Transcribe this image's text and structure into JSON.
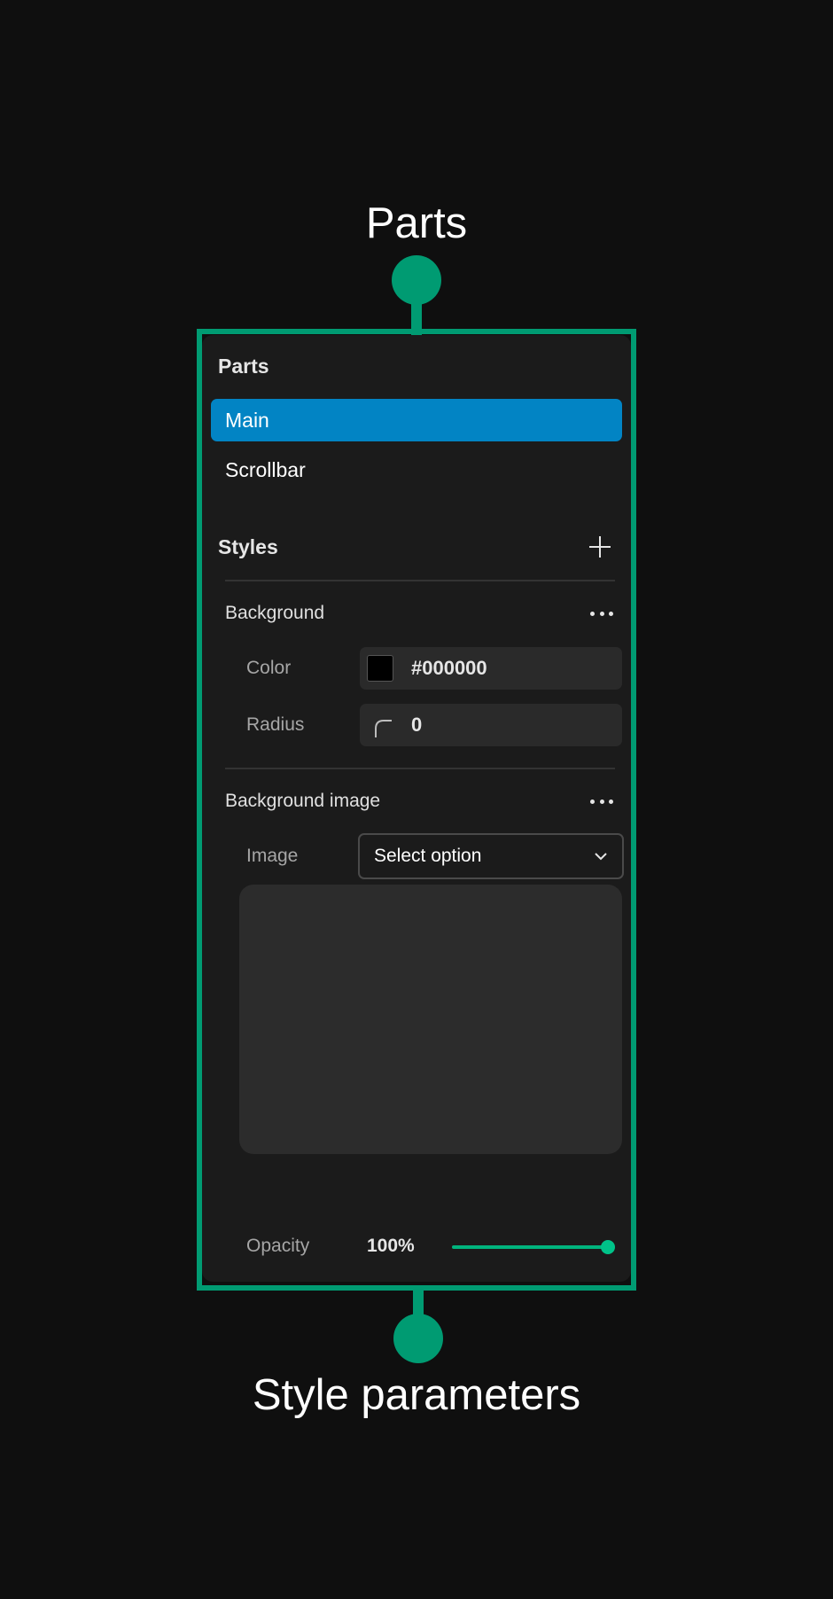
{
  "annotations": {
    "top_label": "Parts",
    "bottom_label": "Style parameters",
    "accent_color": "#009b72"
  },
  "parts": {
    "title": "Parts",
    "items": [
      {
        "label": "Main",
        "selected": true
      },
      {
        "label": "Scrollbar",
        "selected": false
      }
    ]
  },
  "styles": {
    "title": "Styles",
    "add_icon": "plus-icon",
    "background": {
      "title": "Background",
      "menu_icon": "more-icon",
      "color_label": "Color",
      "color_value": "#000000",
      "radius_label": "Radius",
      "radius_value": "0"
    },
    "background_image": {
      "title": "Background image",
      "menu_icon": "more-icon",
      "image_label": "Image",
      "image_select": "Select option",
      "opacity_label": "Opacity",
      "opacity_value": "100%",
      "opacity_fraction": 1.0
    }
  },
  "colors": {
    "selected_item": "#0284c4",
    "slider": "#00b47d"
  }
}
